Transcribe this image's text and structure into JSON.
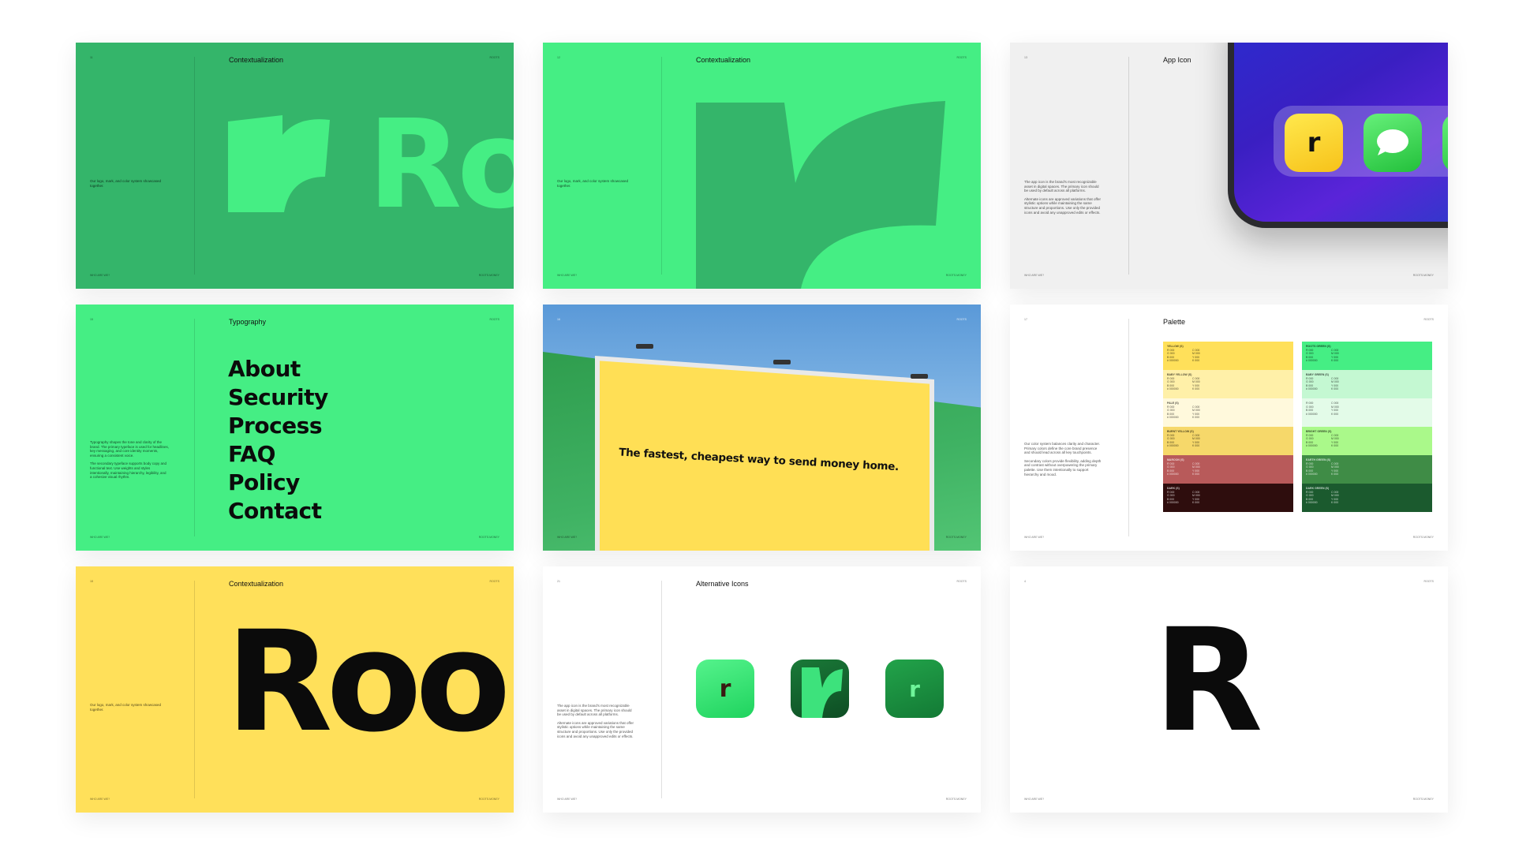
{
  "common": {
    "footer_left": "WHO ARE WE?",
    "footer_right": "ROOTS.MONEY",
    "brand": "ROOTS"
  },
  "cards": {
    "contextualization_green": {
      "page": "11",
      "title": "Contextualization",
      "side_text": "Our logo, mark, and color system showcased together.",
      "wordmark": "Ro"
    },
    "contextualization_mark": {
      "page": "12",
      "title": "Contextualization",
      "side_text": "Our logo, mark, and color system showcased together."
    },
    "app_icon": {
      "page": "13",
      "title": "App Icon",
      "side_text_1": "The app icon is the brand's most recognizable asset in digital spaces. The primary icon should be used by default across all platforms.",
      "side_text_2": "Alternate icons are approved variations that offer stylistic options while maintaining the same structure and proportions. Use only the provided icons and avoid any unapproved edits or effects.",
      "icon_letter": "r"
    },
    "typography": {
      "page": "15",
      "title": "Typography",
      "menu": [
        "About",
        "Security",
        "Process",
        "FAQ",
        "Policy",
        "Contact"
      ],
      "side_text_1": "Typography shapes the tone and clarity of the brand. The primary typeface is used for headlines, key messaging, and core identity moments, ensuring a consistent voice.",
      "side_text_2": "The secondary typeface supports body copy and functional text. Use weights and styles intentionally, maintaining hierarchy, legibility, and a cohesive visual rhythm."
    },
    "billboard": {
      "page": "16",
      "headline": "The fastest, cheapest way to send money home."
    },
    "palette": {
      "page": "17",
      "title": "Palette",
      "side_text_1": "Our color system balances clarity and character. Primary colors define the core brand presence and should lead across all key touchpoints.",
      "side_text_2": "Secondary colors provide flexibility, adding depth and contrast without overpowering the primary palette. Use them intentionally to support hierarchy and mood.",
      "left": [
        {
          "name": "YELLOW (S)",
          "color": "#ffe05a",
          "dark": false
        },
        {
          "name": "BABY YELLOW (S)",
          "color": "#fff0a8",
          "dark": false
        },
        {
          "name": "PALE (S)",
          "color": "#fff9dc",
          "dark": false
        },
        {
          "name": "BURNT YELLOW (S)",
          "color": "#f6d86a",
          "dark": false
        },
        {
          "name": "MAROON (S)",
          "color": "#b85a5a",
          "dark": true
        },
        {
          "name": "DARK (S)",
          "color": "#2e0d0d",
          "dark": true
        }
      ],
      "right": [
        {
          "name": "ROOTS GREEN (S)",
          "color": "#45ee84",
          "dark": false
        },
        {
          "name": "BABY GREEN (S)",
          "color": "#c4f8d2",
          "dark": false
        },
        {
          "name": "",
          "color": "#e3fbe8",
          "dark": false
        },
        {
          "name": "BRIGHT GREEN (S)",
          "color": "#aaf98a",
          "dark": false
        },
        {
          "name": "EARTH GREEN (S)",
          "color": "#3f8c46",
          "dark": true
        },
        {
          "name": "DARK GREEN (S)",
          "color": "#1b5a2e",
          "dark": true
        }
      ],
      "values": [
        "R  000",
        "G  000",
        "B  000",
        "#  000000",
        "C  000",
        "M  000",
        "Y  000",
        "K  000"
      ]
    },
    "contextualization_yellow": {
      "page": "18",
      "title": "Contextualization",
      "side_text": "Our logo, mark, and color system showcased together.",
      "wordmark": "Roo"
    },
    "alternative_icons": {
      "page": "21",
      "title": "Alternative Icons",
      "side_text_1": "The app icon is the brand's most recognizable asset in digital spaces. The primary icon should be used by default across all platforms.",
      "side_text_2": "Alternate icons are approved variations that offer stylistic options while maintaining the same structure and proportions. Use only the provided icons and avoid any unapproved edits or effects.",
      "icon_letter": "r"
    },
    "letter": {
      "page": "4",
      "letter": "R"
    }
  },
  "colors": {
    "green": "#34b56a",
    "bright_green": "#45ee84",
    "yellow": "#ffe05a",
    "black": "#0b0b0b"
  }
}
